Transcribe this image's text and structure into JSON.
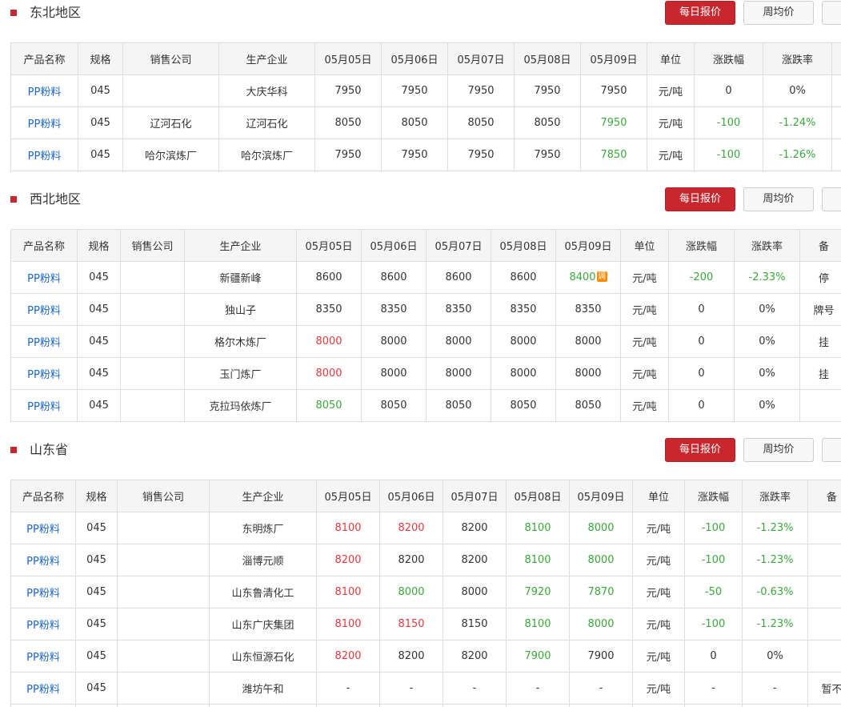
{
  "labels": {
    "daily": "每日报价",
    "weekly": "周均价",
    "adjust_tag": "调"
  },
  "headers": [
    "产品名称",
    "规格",
    "销售公司",
    "生产企业",
    "05月05日",
    "05月06日",
    "05月07日",
    "05月08日",
    "05月09日",
    "单位",
    "涨跌幅",
    "涨跌率",
    "备"
  ],
  "sections": [
    {
      "title": "东北地区",
      "rows": [
        {
          "product": "PP粉料",
          "spec": "045",
          "seller": "",
          "producer": "大庆华科",
          "prices": [
            {
              "v": "7950",
              "c": ""
            },
            {
              "v": "7950",
              "c": ""
            },
            {
              "v": "7950",
              "c": ""
            },
            {
              "v": "7950",
              "c": ""
            },
            {
              "v": "7950",
              "c": ""
            }
          ],
          "unit": "元/吨",
          "change": {
            "v": "0",
            "c": ""
          },
          "rate": {
            "v": "0%",
            "c": ""
          },
          "note": ""
        },
        {
          "product": "PP粉料",
          "spec": "045",
          "seller": "辽河石化",
          "producer": "辽河石化",
          "prices": [
            {
              "v": "8050",
              "c": ""
            },
            {
              "v": "8050",
              "c": ""
            },
            {
              "v": "8050",
              "c": ""
            },
            {
              "v": "8050",
              "c": ""
            },
            {
              "v": "7950",
              "c": "down"
            }
          ],
          "unit": "元/吨",
          "change": {
            "v": "-100",
            "c": "down"
          },
          "rate": {
            "v": "-1.24%",
            "c": "down"
          },
          "note": ""
        },
        {
          "product": "PP粉料",
          "spec": "045",
          "seller": "哈尔滨炼厂",
          "producer": "哈尔滨炼厂",
          "prices": [
            {
              "v": "7950",
              "c": ""
            },
            {
              "v": "7950",
              "c": ""
            },
            {
              "v": "7950",
              "c": ""
            },
            {
              "v": "7950",
              "c": ""
            },
            {
              "v": "7850",
              "c": "down"
            }
          ],
          "unit": "元/吨",
          "change": {
            "v": "-100",
            "c": "down"
          },
          "rate": {
            "v": "-1.26%",
            "c": "down"
          },
          "note": ""
        }
      ]
    },
    {
      "title": "西北地区",
      "rows": [
        {
          "product": "PP粉料",
          "spec": "045",
          "seller": "",
          "producer": "新疆新峰",
          "prices": [
            {
              "v": "8600",
              "c": ""
            },
            {
              "v": "8600",
              "c": ""
            },
            {
              "v": "8600",
              "c": ""
            },
            {
              "v": "8600",
              "c": ""
            },
            {
              "v": "8400",
              "c": "down",
              "tag": true
            }
          ],
          "unit": "元/吨",
          "change": {
            "v": "-200",
            "c": "down"
          },
          "rate": {
            "v": "-2.33%",
            "c": "down"
          },
          "note": "停"
        },
        {
          "product": "PP粉料",
          "spec": "045",
          "seller": "",
          "producer": "独山子",
          "prices": [
            {
              "v": "8350",
              "c": ""
            },
            {
              "v": "8350",
              "c": ""
            },
            {
              "v": "8350",
              "c": ""
            },
            {
              "v": "8350",
              "c": ""
            },
            {
              "v": "8350",
              "c": ""
            }
          ],
          "unit": "元/吨",
          "change": {
            "v": "0",
            "c": ""
          },
          "rate": {
            "v": "0%",
            "c": ""
          },
          "note": "牌号"
        },
        {
          "product": "PP粉料",
          "spec": "045",
          "seller": "",
          "producer": "格尔木炼厂",
          "prices": [
            {
              "v": "8000",
              "c": "up"
            },
            {
              "v": "8000",
              "c": ""
            },
            {
              "v": "8000",
              "c": ""
            },
            {
              "v": "8000",
              "c": ""
            },
            {
              "v": "8000",
              "c": ""
            }
          ],
          "unit": "元/吨",
          "change": {
            "v": "0",
            "c": ""
          },
          "rate": {
            "v": "0%",
            "c": ""
          },
          "note": "挂"
        },
        {
          "product": "PP粉料",
          "spec": "045",
          "seller": "",
          "producer": "玉门炼厂",
          "prices": [
            {
              "v": "8000",
              "c": "up"
            },
            {
              "v": "8000",
              "c": ""
            },
            {
              "v": "8000",
              "c": ""
            },
            {
              "v": "8000",
              "c": ""
            },
            {
              "v": "8000",
              "c": ""
            }
          ],
          "unit": "元/吨",
          "change": {
            "v": "0",
            "c": ""
          },
          "rate": {
            "v": "0%",
            "c": ""
          },
          "note": "挂"
        },
        {
          "product": "PP粉料",
          "spec": "045",
          "seller": "",
          "producer": "克拉玛依炼厂",
          "prices": [
            {
              "v": "8050",
              "c": "down"
            },
            {
              "v": "8050",
              "c": ""
            },
            {
              "v": "8050",
              "c": ""
            },
            {
              "v": "8050",
              "c": ""
            },
            {
              "v": "8050",
              "c": ""
            }
          ],
          "unit": "元/吨",
          "change": {
            "v": "0",
            "c": ""
          },
          "rate": {
            "v": "0%",
            "c": ""
          },
          "note": ""
        }
      ]
    },
    {
      "title": "山东省",
      "rows": [
        {
          "product": "PP粉料",
          "spec": "045",
          "seller": "",
          "producer": "东明炼厂",
          "prices": [
            {
              "v": "8100",
              "c": "up"
            },
            {
              "v": "8200",
              "c": "up"
            },
            {
              "v": "8200",
              "c": ""
            },
            {
              "v": "8100",
              "c": "down"
            },
            {
              "v": "8000",
              "c": "down"
            }
          ],
          "unit": "元/吨",
          "change": {
            "v": "-100",
            "c": "down"
          },
          "rate": {
            "v": "-1.23%",
            "c": "down"
          },
          "note": ""
        },
        {
          "product": "PP粉料",
          "spec": "045",
          "seller": "",
          "producer": "淄博元顺",
          "prices": [
            {
              "v": "8200",
              "c": "up"
            },
            {
              "v": "8200",
              "c": ""
            },
            {
              "v": "8200",
              "c": ""
            },
            {
              "v": "8100",
              "c": "down"
            },
            {
              "v": "8000",
              "c": "down"
            }
          ],
          "unit": "元/吨",
          "change": {
            "v": "-100",
            "c": "down"
          },
          "rate": {
            "v": "-1.23%",
            "c": "down"
          },
          "note": ""
        },
        {
          "product": "PP粉料",
          "spec": "045",
          "seller": "",
          "producer": "山东鲁清化工",
          "prices": [
            {
              "v": "8100",
              "c": "up"
            },
            {
              "v": "8000",
              "c": "down"
            },
            {
              "v": "8000",
              "c": ""
            },
            {
              "v": "7920",
              "c": "down"
            },
            {
              "v": "7870",
              "c": "down"
            }
          ],
          "unit": "元/吨",
          "change": {
            "v": "-50",
            "c": "down"
          },
          "rate": {
            "v": "-0.63%",
            "c": "down"
          },
          "note": ""
        },
        {
          "product": "PP粉料",
          "spec": "045",
          "seller": "",
          "producer": "山东广庆集团",
          "prices": [
            {
              "v": "8100",
              "c": "up"
            },
            {
              "v": "8150",
              "c": "up"
            },
            {
              "v": "8150",
              "c": ""
            },
            {
              "v": "8100",
              "c": "down"
            },
            {
              "v": "8000",
              "c": "down"
            }
          ],
          "unit": "元/吨",
          "change": {
            "v": "-100",
            "c": "down"
          },
          "rate": {
            "v": "-1.23%",
            "c": "down"
          },
          "note": ""
        },
        {
          "product": "PP粉料",
          "spec": "045",
          "seller": "",
          "producer": "山东恒源石化",
          "prices": [
            {
              "v": "8200",
              "c": "up"
            },
            {
              "v": "8200",
              "c": ""
            },
            {
              "v": "8200",
              "c": ""
            },
            {
              "v": "7900",
              "c": "down"
            },
            {
              "v": "7900",
              "c": ""
            }
          ],
          "unit": "元/吨",
          "change": {
            "v": "0",
            "c": ""
          },
          "rate": {
            "v": "0%",
            "c": ""
          },
          "note": ""
        },
        {
          "product": "PP粉料",
          "spec": "045",
          "seller": "",
          "producer": "潍坊午和",
          "prices": [
            {
              "v": "-",
              "c": ""
            },
            {
              "v": "-",
              "c": ""
            },
            {
              "v": "-",
              "c": ""
            },
            {
              "v": "-",
              "c": ""
            },
            {
              "v": "-",
              "c": ""
            }
          ],
          "unit": "元/吨",
          "change": {
            "v": "-",
            "c": ""
          },
          "rate": {
            "v": "-",
            "c": ""
          },
          "note": "暂不"
        },
        {
          "product": "",
          "spec": "",
          "seller": "",
          "producer": "",
          "prices": [
            {
              "v": "",
              "c": ""
            },
            {
              "v": "",
              "c": ""
            },
            {
              "v": "",
              "c": ""
            },
            {
              "v": "",
              "c": ""
            },
            {
              "v": "",
              "c": ""
            }
          ],
          "unit": "",
          "change": {
            "v": "",
            "c": ""
          },
          "rate": {
            "v": "",
            "c": ""
          },
          "note": ""
        }
      ]
    }
  ]
}
